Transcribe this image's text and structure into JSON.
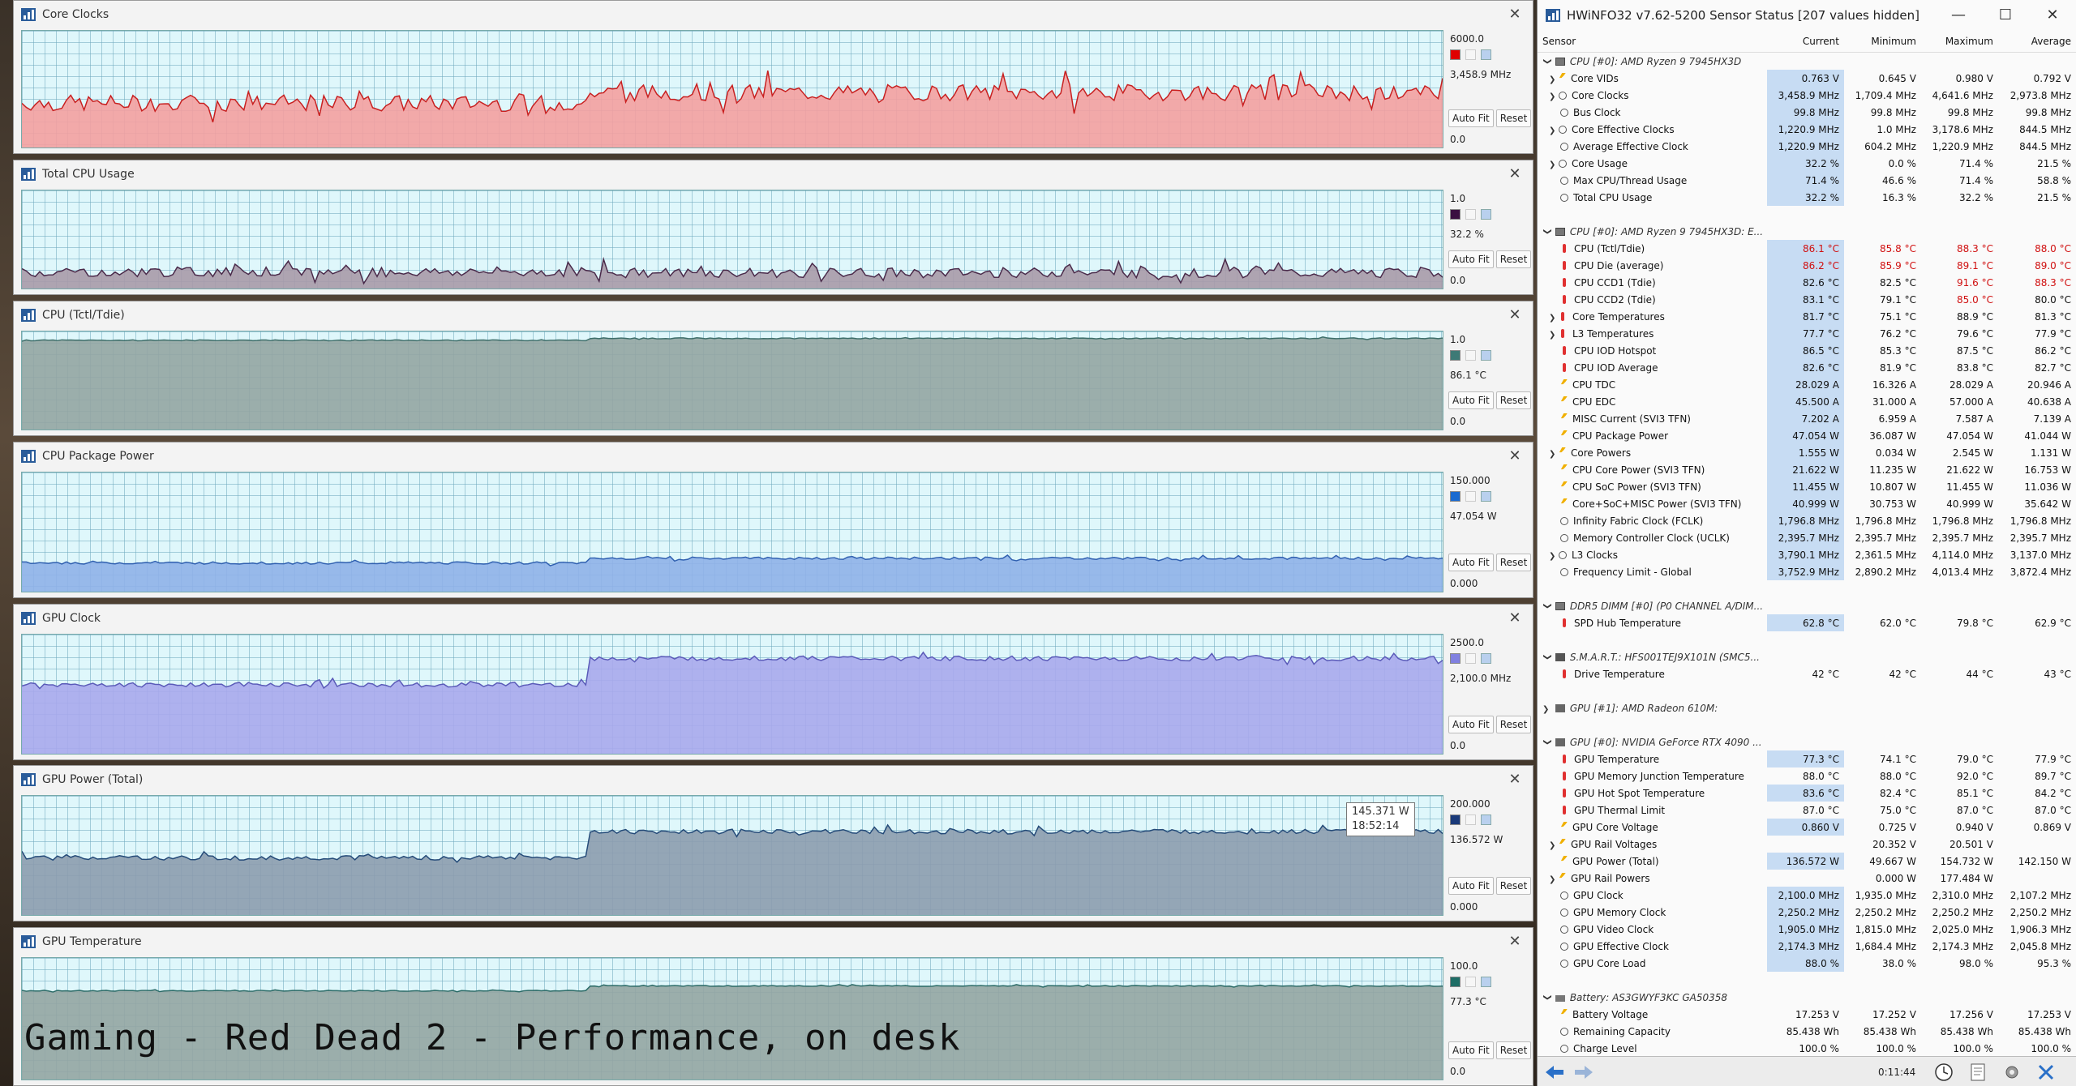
{
  "graphs": [
    {
      "title": "Core Clocks",
      "max": "6000.0",
      "current": "3,458.9 MHz",
      "min": "0.0",
      "color": "#f4a0a0",
      "line": "#c82020",
      "swatch": "#e00000",
      "autofit": "Auto Fit",
      "reset": "Reset",
      "level_before": 0.38,
      "level_after": 0.47,
      "split": 0.4,
      "noise": 0.07
    },
    {
      "title": "Total CPU Usage",
      "max": "1.0",
      "current": "32.2 %",
      "min": "0.0",
      "color": "#a99aa8",
      "line": "#4a2a4a",
      "swatch": "#3a1040",
      "autofit": "Auto Fit",
      "reset": "Reset",
      "level_before": 0.17,
      "level_after": 0.16,
      "split": 0.4,
      "noise": 0.05
    },
    {
      "title": "CPU (Tctl/Tdie)",
      "max": "1.0",
      "current": "86.1 °C",
      "min": "0.0",
      "color": "#93a5a2",
      "line": "#3e6e6a",
      "swatch": "#3e7a76",
      "autofit": "Auto Fit",
      "reset": "Reset",
      "level_before": 0.91,
      "level_after": 0.93,
      "split": 0.4,
      "noise": 0.005
    },
    {
      "title": "CPU Package Power",
      "max": "150.000",
      "current": "47.054 W",
      "min": "0.000",
      "color": "#8fb1e8",
      "line": "#3060b0",
      "swatch": "#1a6ad0",
      "autofit": "Auto Fit",
      "reset": "Reset",
      "level_before": 0.24,
      "level_after": 0.28,
      "split": 0.4,
      "noise": 0.01
    },
    {
      "title": "GPU Clock",
      "max": "2500.0",
      "current": "2,100.0 MHz",
      "min": "0.0",
      "color": "#a8a8ec",
      "line": "#5a5ab8",
      "swatch": "#8080e0",
      "autofit": "Auto Fit",
      "reset": "Reset",
      "level_before": 0.58,
      "level_after": 0.8,
      "split": 0.4,
      "noise": 0.02
    },
    {
      "title": "GPU Power (Total)",
      "max": "200.000",
      "current": "136.572 W",
      "min": "0.000",
      "color": "#8c9cae",
      "line": "#244a78",
      "swatch": "#1a3a7a",
      "autofit": "Auto Fit",
      "reset": "Reset",
      "level_before": 0.48,
      "level_after": 0.7,
      "split": 0.4,
      "noise": 0.02,
      "tooltip": [
        "145.371 W",
        "18:52:14"
      ]
    },
    {
      "title": "GPU Temperature",
      "max": "100.0",
      "current": "77.3 °C",
      "min": "0.0",
      "color": "#93a5a2",
      "line": "#2a6a66",
      "swatch": "#1e6e66",
      "autofit": "Auto Fit",
      "reset": "Reset",
      "level_before": 0.73,
      "level_after": 0.77,
      "split": 0.4,
      "noise": 0.004
    }
  ],
  "overlay_caption": "Gaming - Red Dead 2 - Performance, on desk",
  "sensor_window": {
    "title": "HWiNFO32 v7.62-5200 Sensor Status [207 values hidden]",
    "controls": [
      "—",
      "☐",
      "✕"
    ],
    "headers": [
      "Sensor",
      "Current",
      "Minimum",
      "Maximum",
      "Average"
    ],
    "rows": [
      {
        "type": "group",
        "name": "CPU [#0]: AMD Ryzen 9 7945HX3D",
        "icon": "chip"
      },
      {
        "name": "Core VIDs",
        "icon": "volt",
        "exp": true,
        "ind": 2,
        "v": [
          "0.763 V",
          "0.645 V",
          "0.980 V",
          "0.792 V"
        ]
      },
      {
        "name": "Core Clocks",
        "icon": "clock",
        "exp": true,
        "ind": 2,
        "v": [
          "3,458.9 MHz",
          "1,709.4 MHz",
          "4,641.6 MHz",
          "2,973.8 MHz"
        ]
      },
      {
        "name": "Bus Clock",
        "icon": "clock",
        "ind": 1,
        "v": [
          "99.8 MHz",
          "99.8 MHz",
          "99.8 MHz",
          "99.8 MHz"
        ]
      },
      {
        "name": "Core Effective Clocks",
        "icon": "clock",
        "exp": true,
        "ind": 2,
        "v": [
          "1,220.9 MHz",
          "1.0 MHz",
          "3,178.6 MHz",
          "844.5 MHz"
        ]
      },
      {
        "name": "Average Effective Clock",
        "icon": "clock",
        "ind": 1,
        "v": [
          "1,220.9 MHz",
          "604.2 MHz",
          "1,220.9 MHz",
          "844.5 MHz"
        ]
      },
      {
        "name": "Core Usage",
        "icon": "clock",
        "exp": true,
        "ind": 2,
        "v": [
          "32.2 %",
          "0.0 %",
          "71.4 %",
          "21.5 %"
        ]
      },
      {
        "name": "Max CPU/Thread Usage",
        "icon": "clock",
        "ind": 1,
        "v": [
          "71.4 %",
          "46.6 %",
          "71.4 %",
          "58.8 %"
        ]
      },
      {
        "name": "Total CPU Usage",
        "icon": "clock",
        "ind": 1,
        "v": [
          "32.2 %",
          "16.3 %",
          "32.2 %",
          "21.5 %"
        ]
      },
      {
        "type": "spacer"
      },
      {
        "type": "group",
        "name": "CPU [#0]: AMD Ryzen 9 7945HX3D: E...",
        "icon": "chip"
      },
      {
        "name": "CPU (Tctl/Tdie)",
        "icon": "therm",
        "ind": 1,
        "hot": [
          true,
          true,
          true,
          true
        ],
        "v": [
          "86.1 °C",
          "85.8 °C",
          "88.3 °C",
          "88.0 °C"
        ]
      },
      {
        "name": "CPU Die (average)",
        "icon": "therm",
        "ind": 1,
        "hot": [
          true,
          true,
          true,
          true
        ],
        "v": [
          "86.2 °C",
          "85.9 °C",
          "89.1 °C",
          "89.0 °C"
        ]
      },
      {
        "name": "CPU CCD1 (Tdie)",
        "icon": "therm",
        "ind": 1,
        "hot": [
          false,
          false,
          true,
          true
        ],
        "v": [
          "82.6 °C",
          "82.5 °C",
          "91.6 °C",
          "88.3 °C"
        ]
      },
      {
        "name": "CPU CCD2 (Tdie)",
        "icon": "therm",
        "ind": 1,
        "hot": [
          false,
          false,
          true,
          false
        ],
        "v": [
          "83.1 °C",
          "79.1 °C",
          "85.0 °C",
          "80.0 °C"
        ]
      },
      {
        "name": "Core Temperatures",
        "icon": "therm",
        "exp": true,
        "ind": 2,
        "v": [
          "81.7 °C",
          "75.1 °C",
          "88.9 °C",
          "81.3 °C"
        ]
      },
      {
        "name": "L3 Temperatures",
        "icon": "therm",
        "exp": true,
        "ind": 2,
        "v": [
          "77.7 °C",
          "76.2 °C",
          "79.6 °C",
          "77.9 °C"
        ]
      },
      {
        "name": "CPU IOD Hotspot",
        "icon": "therm",
        "ind": 1,
        "v": [
          "86.5 °C",
          "85.3 °C",
          "87.5 °C",
          "86.2 °C"
        ]
      },
      {
        "name": "CPU IOD Average",
        "icon": "therm",
        "ind": 1,
        "v": [
          "82.6 °C",
          "81.9 °C",
          "83.8 °C",
          "82.7 °C"
        ]
      },
      {
        "name": "CPU TDC",
        "icon": "volt",
        "ind": 1,
        "v": [
          "28.029 A",
          "16.326 A",
          "28.029 A",
          "20.946 A"
        ]
      },
      {
        "name": "CPU EDC",
        "icon": "volt",
        "ind": 1,
        "v": [
          "45.500 A",
          "31.000 A",
          "57.000 A",
          "40.638 A"
        ]
      },
      {
        "name": "MISC Current (SVI3 TFN)",
        "icon": "volt",
        "ind": 1,
        "v": [
          "7.202 A",
          "6.959 A",
          "7.587 A",
          "7.139 A"
        ]
      },
      {
        "name": "CPU Package Power",
        "icon": "volt",
        "ind": 1,
        "v": [
          "47.054 W",
          "36.087 W",
          "47.054 W",
          "41.044 W"
        ]
      },
      {
        "name": "Core Powers",
        "icon": "volt",
        "exp": true,
        "ind": 2,
        "v": [
          "1.555 W",
          "0.034 W",
          "2.545 W",
          "1.131 W"
        ]
      },
      {
        "name": "CPU Core Power (SVI3 TFN)",
        "icon": "volt",
        "ind": 1,
        "v": [
          "21.622 W",
          "11.235 W",
          "21.622 W",
          "16.753 W"
        ]
      },
      {
        "name": "CPU SoC Power (SVI3 TFN)",
        "icon": "volt",
        "ind": 1,
        "v": [
          "11.455 W",
          "10.807 W",
          "11.455 W",
          "11.036 W"
        ]
      },
      {
        "name": "Core+SoC+MISC Power (SVI3 TFN)",
        "icon": "volt",
        "ind": 1,
        "v": [
          "40.999 W",
          "30.753 W",
          "40.999 W",
          "35.642 W"
        ]
      },
      {
        "name": "Infinity Fabric Clock (FCLK)",
        "icon": "clock",
        "ind": 1,
        "v": [
          "1,796.8 MHz",
          "1,796.8 MHz",
          "1,796.8 MHz",
          "1,796.8 MHz"
        ]
      },
      {
        "name": "Memory Controller Clock (UCLK)",
        "icon": "clock",
        "ind": 1,
        "v": [
          "2,395.7 MHz",
          "2,395.7 MHz",
          "2,395.7 MHz",
          "2,395.7 MHz"
        ]
      },
      {
        "name": "L3 Clocks",
        "icon": "clock",
        "exp": true,
        "ind": 2,
        "v": [
          "3,790.1 MHz",
          "2,361.5 MHz",
          "4,114.0 MHz",
          "3,137.0 MHz"
        ]
      },
      {
        "name": "Frequency Limit - Global",
        "icon": "clock",
        "ind": 1,
        "v": [
          "3,752.9 MHz",
          "2,890.2 MHz",
          "4,013.4 MHz",
          "3,872.4 MHz"
        ]
      },
      {
        "type": "spacer"
      },
      {
        "type": "group",
        "name": "DDR5 DIMM [#0] (P0 CHANNEL A/DIM...",
        "icon": "chip"
      },
      {
        "name": "SPD Hub Temperature",
        "icon": "therm",
        "ind": 1,
        "v": [
          "62.8 °C",
          "62.0 °C",
          "79.8 °C",
          "62.9 °C"
        ]
      },
      {
        "type": "spacer"
      },
      {
        "type": "group",
        "name": "S.M.A.R.T.: HFS001TEJ9X101N (SMC5...",
        "icon": "drive"
      },
      {
        "name": "Drive Temperature",
        "icon": "therm",
        "ind": 1,
        "plain": true,
        "v": [
          "42 °C",
          "42 °C",
          "44 °C",
          "43 °C"
        ]
      },
      {
        "type": "spacer"
      },
      {
        "type": "group",
        "name": "GPU [#1]: AMD Radeon 610M:",
        "icon": "gpu",
        "collapsed": true
      },
      {
        "type": "spacer"
      },
      {
        "type": "group",
        "name": "GPU [#0]: NVIDIA GeForce RTX 4090 ...",
        "icon": "gpu"
      },
      {
        "name": "GPU Temperature",
        "icon": "therm",
        "ind": 1,
        "v": [
          "77.3 °C",
          "74.1 °C",
          "79.0 °C",
          "77.9 °C"
        ]
      },
      {
        "name": "GPU Memory Junction Temperature",
        "icon": "therm",
        "ind": 1,
        "plain": true,
        "v": [
          "88.0 °C",
          "88.0 °C",
          "92.0 °C",
          "89.7 °C"
        ]
      },
      {
        "name": "GPU Hot Spot Temperature",
        "icon": "therm",
        "ind": 1,
        "v": [
          "83.6 °C",
          "82.4 °C",
          "85.1 °C",
          "84.2 °C"
        ]
      },
      {
        "name": "GPU Thermal Limit",
        "icon": "therm",
        "ind": 1,
        "plain": true,
        "v": [
          "87.0 °C",
          "75.0 °C",
          "87.0 °C",
          "87.0 °C"
        ]
      },
      {
        "name": "GPU Core Voltage",
        "icon": "volt",
        "ind": 1,
        "v": [
          "0.860 V",
          "0.725 V",
          "0.940 V",
          "0.869 V"
        ]
      },
      {
        "name": "GPU Rail Voltages",
        "icon": "volt",
        "exp": true,
        "ind": 2,
        "plain": true,
        "v": [
          "",
          "20.352 V",
          "20.501 V",
          ""
        ]
      },
      {
        "name": "GPU Power (Total)",
        "icon": "volt",
        "ind": 1,
        "v": [
          "136.572 W",
          "49.667 W",
          "154.732 W",
          "142.150 W"
        ]
      },
      {
        "name": "GPU Rail Powers",
        "icon": "volt",
        "exp": true,
        "ind": 2,
        "plain": true,
        "v": [
          "",
          "0.000 W",
          "177.484 W",
          ""
        ]
      },
      {
        "name": "GPU Clock",
        "icon": "clock",
        "ind": 1,
        "v": [
          "2,100.0 MHz",
          "1,935.0 MHz",
          "2,310.0 MHz",
          "2,107.2 MHz"
        ]
      },
      {
        "name": "GPU Memory Clock",
        "icon": "clock",
        "ind": 1,
        "v": [
          "2,250.2 MHz",
          "2,250.2 MHz",
          "2,250.2 MHz",
          "2,250.2 MHz"
        ]
      },
      {
        "name": "GPU Video Clock",
        "icon": "clock",
        "ind": 1,
        "v": [
          "1,905.0 MHz",
          "1,815.0 MHz",
          "2,025.0 MHz",
          "1,906.3 MHz"
        ]
      },
      {
        "name": "GPU Effective Clock",
        "icon": "clock",
        "ind": 1,
        "v": [
          "2,174.3 MHz",
          "1,684.4 MHz",
          "2,174.3 MHz",
          "2,045.8 MHz"
        ]
      },
      {
        "name": "GPU Core Load",
        "icon": "clock",
        "ind": 1,
        "v": [
          "88.0 %",
          "38.0 %",
          "98.0 %",
          "95.3 %"
        ]
      },
      {
        "type": "spacer"
      },
      {
        "type": "group",
        "name": "Battery: AS3GWYF3KC GA50358",
        "icon": "bat"
      },
      {
        "name": "Battery Voltage",
        "icon": "volt",
        "ind": 1,
        "plain": true,
        "v": [
          "17.253 V",
          "17.252 V",
          "17.256 V",
          "17.253 V"
        ]
      },
      {
        "name": "Remaining Capacity",
        "icon": "clock",
        "ind": 1,
        "plain": true,
        "v": [
          "85.438 Wh",
          "85.438 Wh",
          "85.438 Wh",
          "85.438 Wh"
        ]
      },
      {
        "name": "Charge Level",
        "icon": "clock",
        "ind": 1,
        "plain": true,
        "v": [
          "100.0 %",
          "100.0 %",
          "100.0 %",
          "100.0 %"
        ]
      }
    ],
    "footer_time": "0:11:44"
  }
}
